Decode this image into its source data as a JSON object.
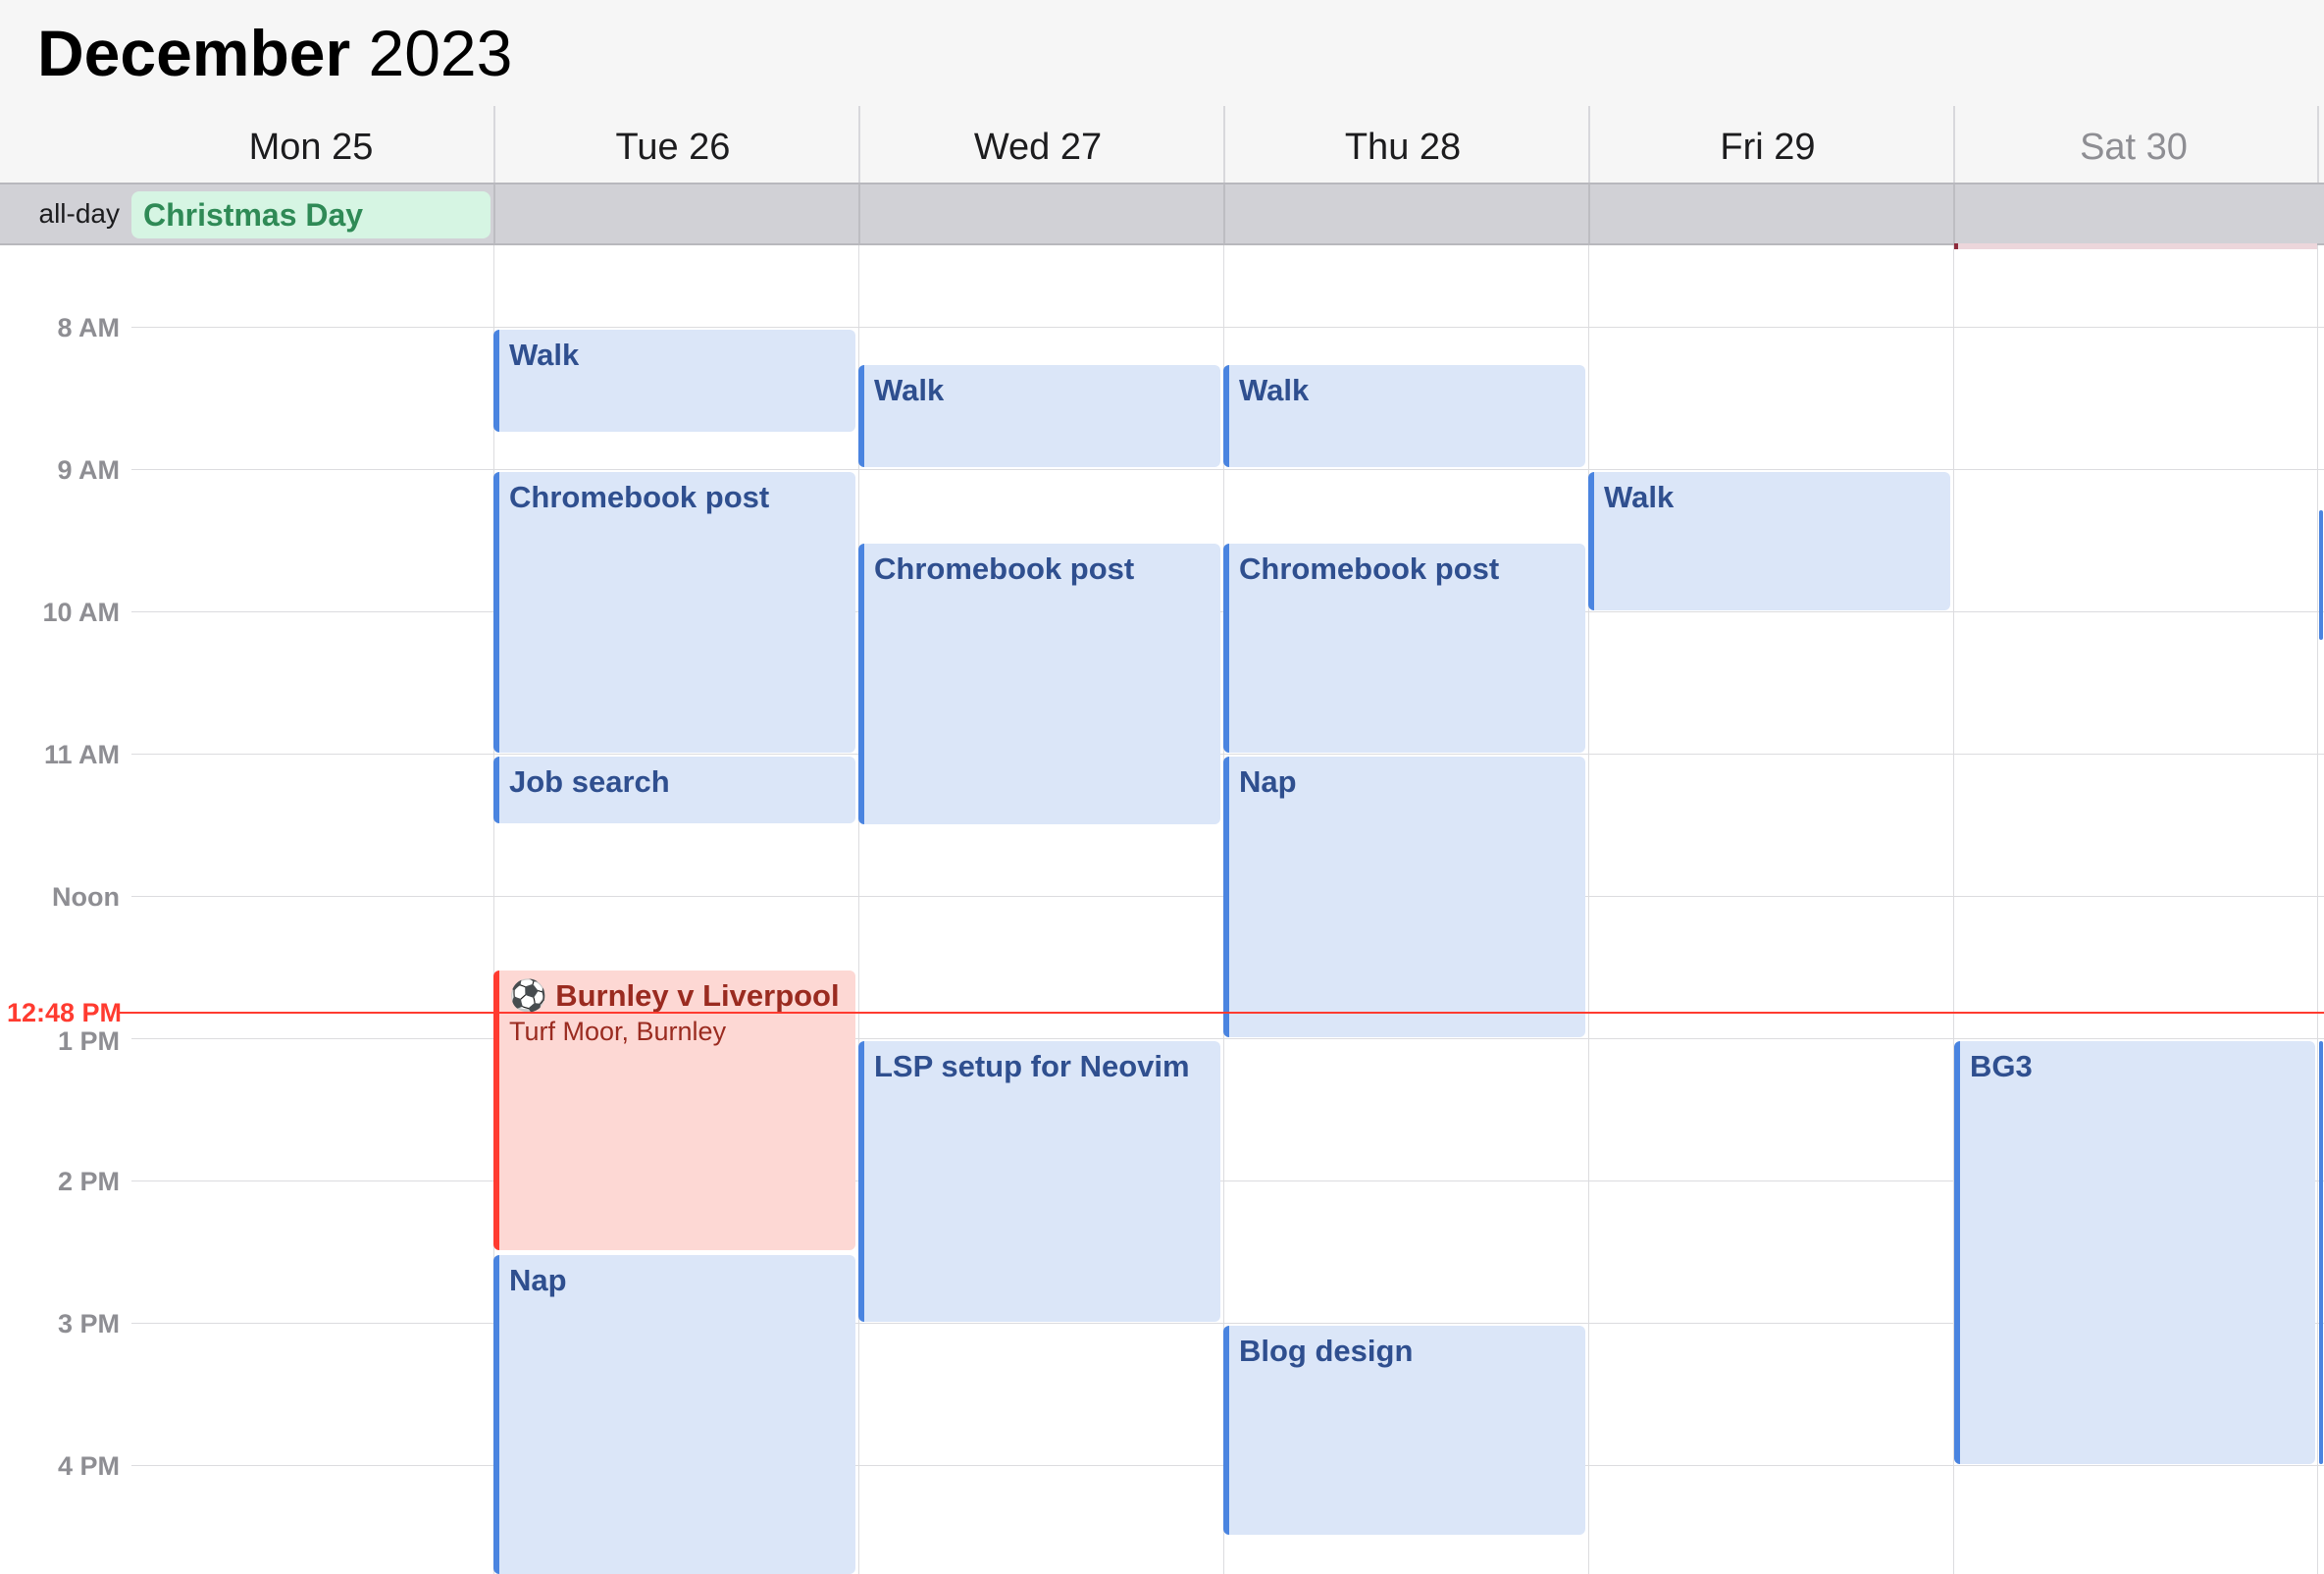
{
  "header": {
    "month": "December",
    "year": "2023"
  },
  "days": [
    {
      "label": "Mon 25",
      "weekend": false
    },
    {
      "label": "Tue 26",
      "weekend": false
    },
    {
      "label": "Wed 27",
      "weekend": false
    },
    {
      "label": "Thu 28",
      "weekend": false
    },
    {
      "label": "Fri 29",
      "weekend": false
    },
    {
      "label": "Sat 30",
      "weekend": true
    }
  ],
  "allday": {
    "label": "all-day",
    "events": [
      {
        "title": "Christmas Day",
        "day": "Mon 25"
      }
    ]
  },
  "time_labels": [
    "8 AM",
    "9 AM",
    "10 AM",
    "11 AM",
    "Noon",
    "1 PM",
    "2 PM",
    "3 PM",
    "4 PM"
  ],
  "now": {
    "label": "12:48 PM"
  },
  "events": [
    {
      "title": "Walk",
      "day": "Tue 26"
    },
    {
      "title": "Chromebook post",
      "day": "Tue 26"
    },
    {
      "title": "Job search",
      "day": "Tue 26"
    },
    {
      "title": "⚽ Burnley v Liverpool",
      "location": "Turf Moor, Burnley",
      "day": "Tue 26",
      "color": "#ff3b30"
    },
    {
      "title": "Nap",
      "day": "Tue 26"
    },
    {
      "title": "Walk",
      "day": "Wed 27"
    },
    {
      "title": "Chromebook post",
      "day": "Wed 27"
    },
    {
      "title": "LSP setup for Neovim",
      "day": "Wed 27"
    },
    {
      "title": "Walk",
      "day": "Thu 28"
    },
    {
      "title": "Chromebook post",
      "day": "Thu 28"
    },
    {
      "title": "Nap",
      "day": "Thu 28"
    },
    {
      "title": "Blog design",
      "day": "Thu 28"
    },
    {
      "title": "Walk",
      "day": "Fri 29"
    },
    {
      "title": "BG3",
      "day": "Sat 30"
    }
  ],
  "colors": {
    "event_blue": "#4a84e0",
    "event_red": "#ff3b30",
    "holiday_green": "#2f8a56",
    "now_red": "#ff3b30"
  }
}
